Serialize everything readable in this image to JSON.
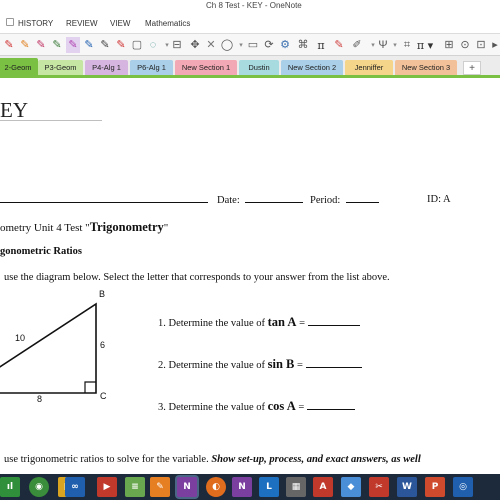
{
  "window": {
    "title": "Ch 8 Test - KEY - OneNote"
  },
  "menu": {
    "items": [
      "HISTORY",
      "REVIEW",
      "VIEW",
      "Mathematics"
    ]
  },
  "toolbar": {
    "pi_symbol": "π",
    "pi_dropdown": "π ▾",
    "close_x": "✕",
    "more": "▸"
  },
  "sections": [
    {
      "label": "2-Geom",
      "color": "#7ac143",
      "active": true
    },
    {
      "label": "P3-Geom",
      "color": "#c6e6a4"
    },
    {
      "label": "P4-Alg 1",
      "color": "#d6b6e0"
    },
    {
      "label": "P6-Alg 1",
      "color": "#a9cfe9"
    },
    {
      "label": "New Section 1",
      "color": "#f3a9b5"
    },
    {
      "label": "Dustin",
      "color": "#a8dbe0"
    },
    {
      "label": "New Section 2",
      "color": "#a9cfe9"
    },
    {
      "label": "Jenniffer",
      "color": "#f5d58a"
    },
    {
      "label": "New Section 3",
      "color": "#f2c199"
    }
  ],
  "add_section": "+",
  "page": {
    "title": "EY",
    "date_label": "Date:",
    "period_label": "Period:",
    "id_label": "ID: A",
    "test_title_prefix": "ometry Unit 4 Test \"",
    "test_title_bold": "Trigonometry",
    "test_title_suffix": "\"",
    "section_heading": "gonometric Ratios",
    "instruction": "use the diagram below.  Select the letter that corresponds to your answer from the list above.",
    "questions": [
      {
        "prefix": "1.  Determine the value of ",
        "func": "tan A",
        "suffix": " = "
      },
      {
        "prefix": "2.  Determine the value of ",
        "func": "sin B",
        "suffix": " = "
      },
      {
        "prefix": "3.  Determine the value of ",
        "func": "cos A",
        "suffix": " = "
      }
    ],
    "diagram": {
      "label_b": "B",
      "label_c": "C",
      "side_hyp": "10",
      "side_bc": "6",
      "side_ac": "8"
    },
    "bottom_text_plain": "use trigonometric ratios to solve for the variable.  ",
    "bottom_text_emph": "Show set-up, process, and exact answers, as well"
  },
  "taskbar": {
    "icons": [
      {
        "name": "excel-taskbar-icon",
        "glyph": "ıl",
        "color": "#2f8f3a"
      },
      {
        "name": "chrome-taskbar-icon",
        "glyph": "◉",
        "color": "#3a8d3a"
      },
      {
        "name": "explorer-taskbar-icon",
        "glyph": "▤",
        "color": "#d9a520"
      },
      {
        "name": "app-taskbar-icon",
        "glyph": "∞",
        "color": "#1f5fae"
      },
      {
        "name": "media-taskbar-icon",
        "glyph": "▶",
        "color": "#c0392b"
      },
      {
        "name": "notes-taskbar-icon",
        "glyph": "≡",
        "color": "#6aa84f"
      },
      {
        "name": "paint-taskbar-icon",
        "glyph": "✎",
        "color": "#e67e22"
      },
      {
        "name": "onenote-taskbar-icon",
        "glyph": "N",
        "color": "#7b3fa0"
      },
      {
        "name": "firefox-taskbar-icon",
        "glyph": "◐",
        "color": "#e06c1e"
      },
      {
        "name": "onenote2-taskbar-icon",
        "glyph": "N",
        "color": "#7b3fa0"
      },
      {
        "name": "lync-taskbar-icon",
        "glyph": "L",
        "color": "#1d6fbf"
      },
      {
        "name": "tool-taskbar-icon",
        "glyph": "▦",
        "color": "#666666"
      },
      {
        "name": "acrobat-taskbar-icon",
        "glyph": "A",
        "color": "#c0392b"
      },
      {
        "name": "photos-taskbar-icon",
        "glyph": "◆",
        "color": "#4a8ed8"
      },
      {
        "name": "snip-taskbar-icon",
        "glyph": "✂",
        "color": "#c0392b"
      },
      {
        "name": "word-taskbar-icon",
        "glyph": "W",
        "color": "#2b579a"
      },
      {
        "name": "ppt-taskbar-icon",
        "glyph": "P",
        "color": "#d04a2e"
      },
      {
        "name": "app2-taskbar-icon",
        "glyph": "◎",
        "color": "#1f5fae"
      }
    ]
  }
}
